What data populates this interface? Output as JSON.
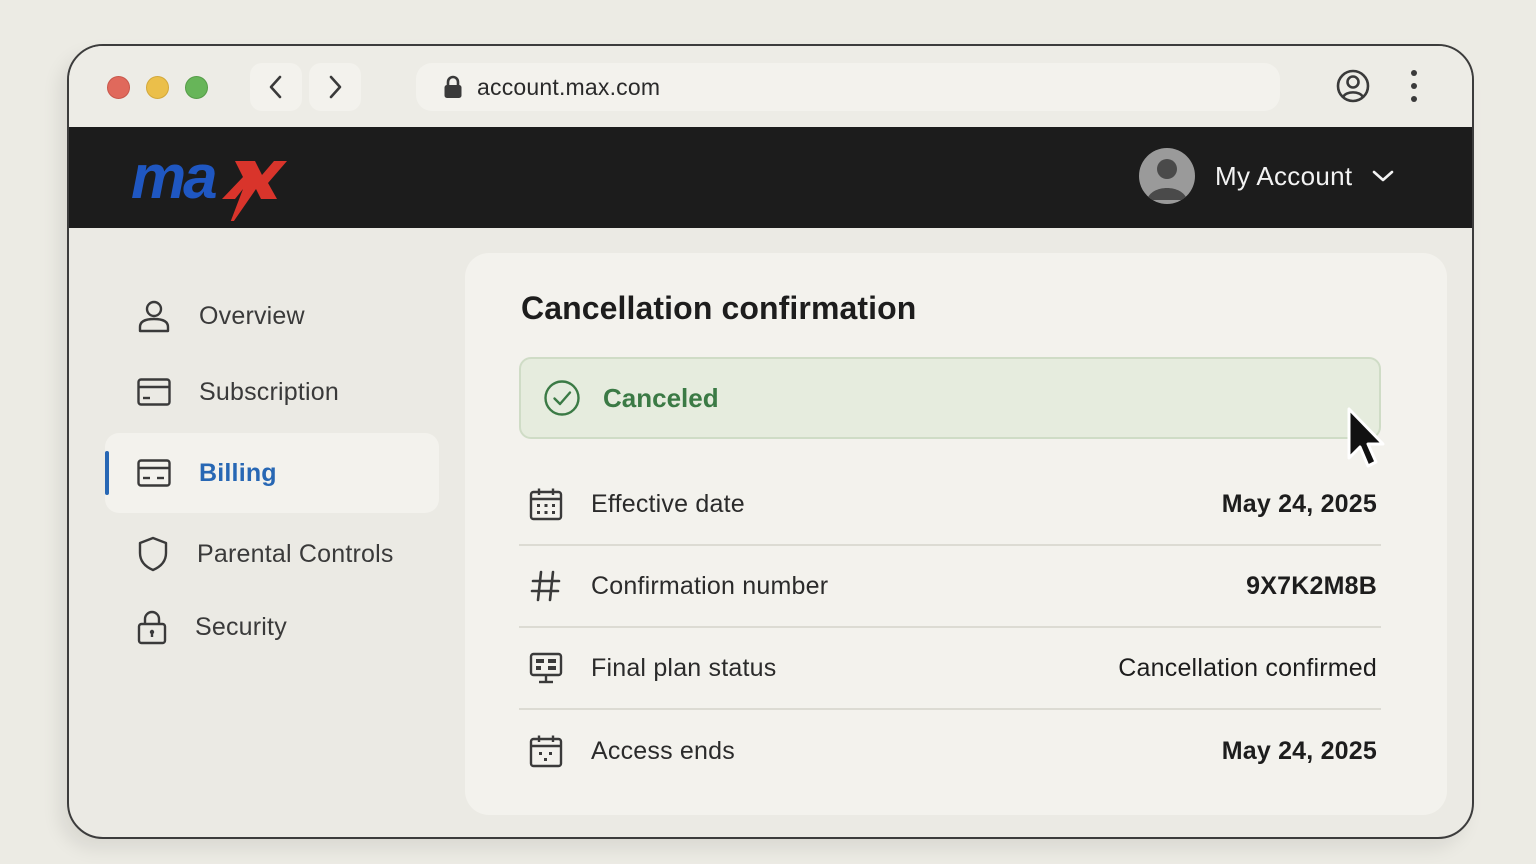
{
  "browser": {
    "url": "account.max.com",
    "icons": {
      "back": "chevron-left-icon",
      "forward": "chevron-right-icon",
      "lock": "lock-icon",
      "profile": "profile-icon",
      "menu": "kebab-menu-icon"
    }
  },
  "header": {
    "logo_text": "max",
    "account_label": "My Account",
    "colors": {
      "background": "#1c1c1c",
      "logo_blue": "#1f57c2",
      "logo_red": "#d9342b"
    }
  },
  "sidebar": {
    "items": [
      {
        "label": "Overview",
        "icon": "user-icon",
        "active": false
      },
      {
        "label": "Subscription",
        "icon": "card-icon",
        "active": false
      },
      {
        "label": "Billing",
        "icon": "card-icon",
        "active": true
      },
      {
        "label": "Parental Controls",
        "icon": "shield-icon",
        "active": false
      },
      {
        "label": "Security",
        "icon": "lock-icon",
        "active": false
      }
    ],
    "accent_color": "#2767b4"
  },
  "main": {
    "title": "Cancellation confirmation",
    "status": {
      "label": "Canceled",
      "icon": "check-circle-icon",
      "color": "#3b7a45"
    },
    "details": [
      {
        "label": "Effective date",
        "value": "May 24, 2025",
        "icon": "calendar-icon"
      },
      {
        "label": "Confirmation number",
        "value": "9X7K2M8B",
        "icon": "hash-icon"
      },
      {
        "label": "Final plan status",
        "value": "Cancellation confirmed",
        "icon": "monitor-icon"
      },
      {
        "label": "Access ends",
        "value": "May 24, 2025",
        "icon": "calendar-icon"
      }
    ]
  }
}
